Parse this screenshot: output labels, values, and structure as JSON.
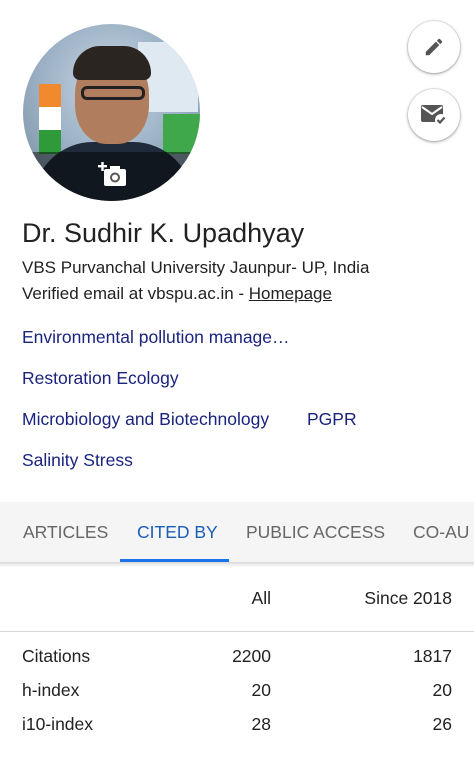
{
  "profile": {
    "name": "Dr. Sudhir K. Upadhyay",
    "affiliation": "VBS Purvanchal University Jaunpur- UP, India",
    "email_text": "Verified email at vbspu.ac.in - ",
    "homepage_label": "Homepage"
  },
  "interests": [
    "Environmental pollution manage…",
    "Restoration Ecology",
    "Microbiology and Biotechnology",
    "PGPR",
    "Salinity Stress"
  ],
  "tabs": {
    "articles": "ARTICLES",
    "cited_by": "CITED BY",
    "public_access": "PUBLIC ACCESS",
    "co_authors": "CO-AU",
    "active": "CITED BY"
  },
  "stats": {
    "header_all": "All",
    "header_since": "Since 2018",
    "rows": [
      {
        "label": "Citations",
        "all": "2200",
        "since": "1817"
      },
      {
        "label": "h-index",
        "all": "20",
        "since": "20"
      },
      {
        "label": "i10-index",
        "all": "28",
        "since": "26"
      }
    ]
  },
  "icons": {
    "edit": "pencil-icon",
    "mail": "mail-check-icon",
    "photo": "add-photo-icon"
  },
  "colors": {
    "link": "#1a237e",
    "active_tab": "#1a73e8"
  }
}
